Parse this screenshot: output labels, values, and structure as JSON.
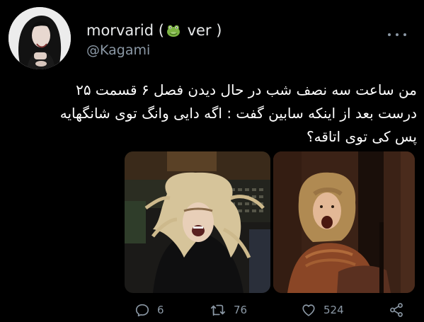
{
  "user": {
    "display_name_start": "morvarid (",
    "display_name_end": " ver )",
    "name_emoji": "frog-face",
    "handle": "@Kagami"
  },
  "tweet": {
    "lines": [
      "من ساعت سه نصف شب در حال دیدن فصل ۶ قسمت ۲۵",
      "درست بعد از اینکه سابین گفت : اگه دایی وانگ توی شانگهایه",
      "پس کی توی اتاقه؟"
    ]
  },
  "actions": {
    "replies": "6",
    "retweets": "76",
    "likes": "524"
  },
  "colors": {
    "background": "#000000",
    "text": "#e7e9ea",
    "muted": "#8b98a5"
  }
}
